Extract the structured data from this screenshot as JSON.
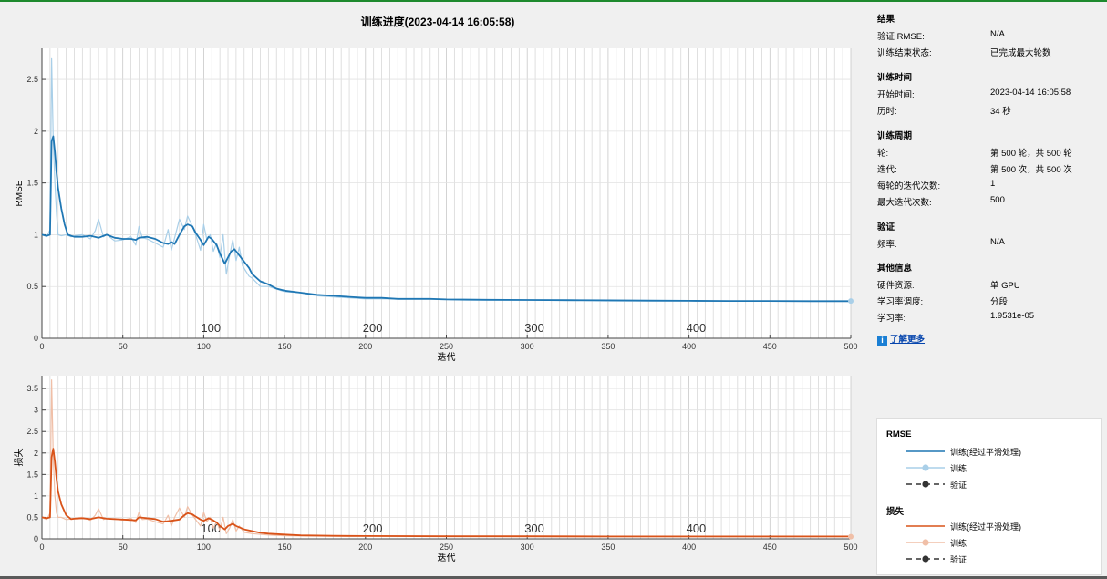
{
  "title": "训练进度(2023-04-14 16:05:58)",
  "colors": {
    "train_smoothed": "#1f77b4",
    "train_raw": "#a9cfe8",
    "loss_smoothed": "#d95319",
    "loss_raw": "#f0bfa7",
    "validation": "#333333",
    "grid": "#e2e2e2",
    "epoch_line": "#d8d8d8",
    "top_border": "#1e8a2e"
  },
  "chart_data": [
    {
      "type": "line",
      "title": "",
      "xlabel": "迭代",
      "ylabel": "RMSE",
      "xlim": [
        0,
        500
      ],
      "ylim": [
        0,
        2.8
      ],
      "xticks": [
        0,
        50,
        100,
        150,
        200,
        250,
        300,
        350,
        400,
        450,
        500
      ],
      "yticks": [
        0,
        0.5,
        1,
        1.5,
        2,
        2.5
      ],
      "ytick_labels": [
        "0",
        "0.5",
        "1",
        "1.5",
        "2",
        "2.5"
      ],
      "epoch_labels": [
        "100",
        "200",
        "300",
        "400"
      ],
      "grid": true,
      "series": [
        {
          "name": "训练(经过平滑处理)",
          "x": [
            0,
            3,
            5,
            6,
            7,
            8,
            9,
            10,
            11,
            12,
            14,
            16,
            18,
            20,
            25,
            30,
            35,
            40,
            45,
            50,
            55,
            58,
            60,
            65,
            70,
            75,
            78,
            80,
            82,
            85,
            88,
            90,
            93,
            95,
            98,
            100,
            103,
            105,
            108,
            110,
            113,
            115,
            117,
            119,
            120,
            122,
            125,
            128,
            130,
            135,
            140,
            145,
            150,
            160,
            170,
            180,
            190,
            200,
            210,
            220,
            230,
            240,
            250,
            275,
            300,
            325,
            350,
            375,
            400,
            425,
            450,
            475,
            500
          ],
          "y": [
            1.0,
            0.99,
            1.0,
            1.9,
            1.95,
            1.8,
            1.6,
            1.45,
            1.35,
            1.25,
            1.1,
            1.0,
            0.99,
            0.98,
            0.98,
            0.99,
            0.97,
            1.0,
            0.97,
            0.96,
            0.96,
            0.95,
            0.97,
            0.98,
            0.96,
            0.92,
            0.91,
            0.93,
            0.91,
            1.0,
            1.08,
            1.1,
            1.08,
            1.02,
            0.95,
            0.9,
            0.98,
            0.96,
            0.9,
            0.82,
            0.72,
            0.78,
            0.84,
            0.86,
            0.84,
            0.8,
            0.74,
            0.68,
            0.62,
            0.55,
            0.52,
            0.48,
            0.46,
            0.44,
            0.42,
            0.41,
            0.4,
            0.39,
            0.39,
            0.38,
            0.38,
            0.38,
            0.375,
            0.372,
            0.37,
            0.368,
            0.366,
            0.364,
            0.362,
            0.36,
            0.36,
            0.358,
            0.358
          ]
        },
        {
          "name": "训练",
          "x": [
            0,
            3,
            5,
            6,
            7,
            8,
            9,
            10,
            12,
            15,
            18,
            20,
            25,
            30,
            33,
            35,
            38,
            40,
            45,
            50,
            55,
            58,
            60,
            62,
            65,
            70,
            75,
            78,
            80,
            82,
            85,
            88,
            90,
            93,
            95,
            98,
            100,
            102,
            104,
            106,
            108,
            110,
            112,
            114,
            116,
            118,
            120,
            122,
            124,
            128,
            130,
            135,
            140,
            150,
            160,
            170,
            180,
            200,
            220,
            240,
            260,
            300,
            350,
            400,
            450,
            500
          ],
          "y": [
            1.0,
            0.98,
            1.05,
            2.7,
            1.9,
            1.5,
            1.2,
            1.0,
            0.99,
            1.0,
            0.98,
            0.99,
            1.0,
            0.96,
            1.04,
            1.15,
            0.98,
            1.0,
            0.94,
            0.95,
            0.98,
            0.9,
            1.08,
            0.97,
            0.96,
            0.92,
            0.88,
            1.05,
            0.85,
            0.97,
            1.15,
            1.05,
            1.18,
            1.08,
            1.0,
            0.85,
            1.1,
            0.95,
            1.0,
            0.84,
            0.92,
            0.78,
            1.0,
            0.62,
            0.8,
            0.95,
            0.75,
            0.88,
            0.7,
            0.6,
            0.58,
            0.5,
            0.5,
            0.45,
            0.44,
            0.41,
            0.4,
            0.38,
            0.38,
            0.38,
            0.37,
            0.37,
            0.36,
            0.36,
            0.36,
            0.36
          ]
        }
      ]
    },
    {
      "type": "line",
      "title": "",
      "xlabel": "迭代",
      "ylabel": "损失",
      "xlim": [
        0,
        500
      ],
      "ylim": [
        0,
        3.8
      ],
      "xticks": [
        0,
        50,
        100,
        150,
        200,
        250,
        300,
        350,
        400,
        450,
        500
      ],
      "yticks": [
        0,
        0.5,
        1,
        1.5,
        2,
        2.5,
        3,
        3.5
      ],
      "ytick_labels": [
        "0",
        "0.5",
        "1",
        "1.5",
        "2",
        "2.5",
        "3",
        "3.5"
      ],
      "epoch_labels": [
        "100",
        "200",
        "300",
        "400"
      ],
      "grid": true,
      "series": [
        {
          "name": "训练(经过平滑处理)",
          "x": [
            0,
            3,
            5,
            6,
            7,
            8,
            9,
            10,
            12,
            15,
            18,
            20,
            25,
            30,
            35,
            40,
            50,
            55,
            58,
            60,
            65,
            70,
            75,
            80,
            85,
            88,
            90,
            93,
            95,
            98,
            100,
            103,
            105,
            108,
            110,
            113,
            115,
            118,
            120,
            125,
            130,
            135,
            140,
            150,
            160,
            180,
            200,
            250,
            300,
            350,
            400,
            450,
            500
          ],
          "y": [
            0.5,
            0.48,
            0.5,
            1.9,
            2.1,
            1.8,
            1.4,
            1.1,
            0.8,
            0.55,
            0.46,
            0.47,
            0.48,
            0.46,
            0.5,
            0.47,
            0.45,
            0.44,
            0.43,
            0.5,
            0.48,
            0.46,
            0.4,
            0.42,
            0.45,
            0.55,
            0.6,
            0.57,
            0.52,
            0.45,
            0.42,
            0.48,
            0.45,
            0.38,
            0.3,
            0.22,
            0.3,
            0.35,
            0.3,
            0.22,
            0.18,
            0.14,
            0.12,
            0.1,
            0.08,
            0.07,
            0.065,
            0.06,
            0.06,
            0.055,
            0.055,
            0.055,
            0.055
          ]
        },
        {
          "name": "训练",
          "x": [
            0,
            3,
            5,
            6,
            7,
            8,
            9,
            10,
            12,
            15,
            18,
            20,
            25,
            30,
            33,
            35,
            38,
            40,
            50,
            55,
            58,
            60,
            62,
            65,
            70,
            75,
            78,
            80,
            82,
            85,
            88,
            90,
            93,
            95,
            98,
            100,
            102,
            104,
            106,
            108,
            110,
            112,
            114,
            116,
            118,
            120,
            122,
            125,
            130,
            140,
            150,
            200,
            250,
            300,
            350,
            400,
            450,
            500
          ],
          "y": [
            0.5,
            0.45,
            0.6,
            3.7,
            1.9,
            1.0,
            0.6,
            0.5,
            0.5,
            0.45,
            0.46,
            0.48,
            0.5,
            0.43,
            0.55,
            0.7,
            0.45,
            0.48,
            0.44,
            0.48,
            0.38,
            0.62,
            0.45,
            0.46,
            0.4,
            0.35,
            0.55,
            0.3,
            0.5,
            0.72,
            0.5,
            0.75,
            0.55,
            0.45,
            0.3,
            0.62,
            0.4,
            0.5,
            0.25,
            0.4,
            0.2,
            0.5,
            0.12,
            0.25,
            0.45,
            0.18,
            0.3,
            0.15,
            0.12,
            0.09,
            0.07,
            0.06,
            0.06,
            0.05,
            0.05,
            0.05,
            0.05,
            0.05
          ]
        }
      ]
    }
  ],
  "info": {
    "results": {
      "title": "结果",
      "rows": [
        {
          "label": "验证 RMSE:",
          "value": "N/A"
        },
        {
          "label": "训练结束状态:",
          "value": "已完成最大轮数"
        }
      ]
    },
    "time": {
      "title": "训练时间",
      "rows": [
        {
          "label": "开始时间:",
          "value": "2023-04-14 16:05:58"
        },
        {
          "label": "历时:",
          "value": "34 秒"
        }
      ]
    },
    "cycle": {
      "title": "训练周期",
      "rows": [
        {
          "label": "轮:",
          "value": "第 500 轮，共 500 轮"
        },
        {
          "label": "迭代:",
          "value": "第 500 次，共 500 次"
        },
        {
          "label": "每轮的迭代次数:",
          "value": "1"
        },
        {
          "label": "最大迭代次数:",
          "value": "500"
        }
      ]
    },
    "validation": {
      "title": "验证",
      "rows": [
        {
          "label": "频率:",
          "value": "N/A"
        }
      ]
    },
    "other": {
      "title": "其他信息",
      "rows": [
        {
          "label": "硬件资源:",
          "value": "单 GPU"
        },
        {
          "label": "学习率调度:",
          "value": "分段"
        },
        {
          "label": "学习率:",
          "value": "1.9531e-05"
        }
      ]
    },
    "learn_more": "了解更多",
    "learn_more_icon": "info-icon"
  },
  "legend": {
    "rmse_title": "RMSE",
    "loss_title": "损失",
    "items": {
      "smoothed": "训练(经过平滑处理)",
      "raw": "训练",
      "val": "验证"
    }
  }
}
